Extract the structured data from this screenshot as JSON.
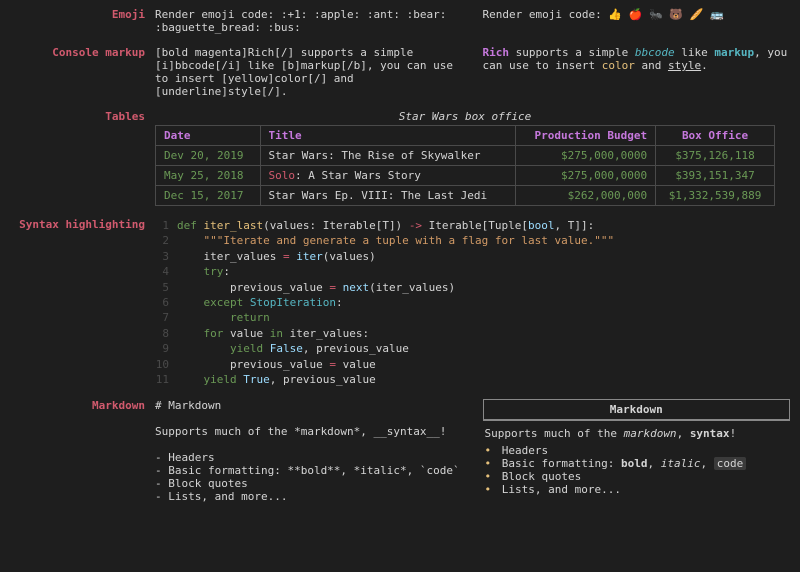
{
  "sections": {
    "emoji": {
      "label": "Emoji",
      "raw": "Render emoji code: :+1: :apple: :ant: :bear: :baguette_bread: :bus:",
      "rendered_prefix": "Render emoji code: ",
      "rendered_emoji": "👍 🍎 🐜 🐻 🥖 🚌"
    },
    "console": {
      "label": "Console markup",
      "raw": "[bold magenta]Rich[/] supports a simple [i]bbcode[/i] like [b]markup[/b], you can use to insert [yellow]color[/] and [underline]style[/].",
      "rich_word": "Rich",
      "text1": " supports a simple ",
      "bbcode": "bbcode",
      "text2": " like ",
      "markup": "markup",
      "text3": ", you can use to insert ",
      "color": "color",
      "text4": " and ",
      "style": "style",
      "text5": "."
    },
    "tables": {
      "label": "Tables",
      "title": "Star Wars box office",
      "headers": [
        "Date",
        "Title",
        "Production Budget",
        "Box Office"
      ],
      "rows": [
        {
          "date": "Dev 20, 2019",
          "title_pre": "",
          "title_hl": "",
          "title_post": "Star Wars: The Rise of Skywalker",
          "budget": "$275,000,0000",
          "box": "$375,126,118"
        },
        {
          "date": "May 25, 2018",
          "title_pre": "",
          "title_hl": "Solo",
          "title_post": ": A Star Wars Story",
          "budget": "$275,000,0000",
          "box": "$393,151,347"
        },
        {
          "date": "Dec 15, 2017",
          "title_pre": "",
          "title_hl": "",
          "title_post": "Star Wars Ep. VIII: The Last Jedi",
          "budget": "$262,000,000",
          "box": "$1,332,539,889"
        }
      ]
    },
    "syntax": {
      "label": "Syntax highlighting",
      "lines": [
        {
          "n": "1",
          "html": "<span class='kw'>def</span> <span class='fn'>iter_last</span>(values: Iterable[T]) <span class='op'>-&gt;</span> Iterable[Tuple[<span class='builtin'>bool</span>, T]]:"
        },
        {
          "n": "2",
          "html": "    <span class='str'>\"\"\"Iterate and generate a tuple with a flag for last value.\"\"\"</span>"
        },
        {
          "n": "3",
          "html": "    iter_values <span class='op'>=</span> <span class='builtin'>iter</span>(values)"
        },
        {
          "n": "4",
          "html": "    <span class='kw'>try</span>:"
        },
        {
          "n": "5",
          "html": "        previous_value <span class='op'>=</span> <span class='builtin'>next</span>(iter_values)"
        },
        {
          "n": "6",
          "html": "    <span class='kw'>except</span> <span class='cls'>StopIteration</span>:"
        },
        {
          "n": "7",
          "html": "        <span class='kw'>return</span>"
        },
        {
          "n": "8",
          "html": "    <span class='kw'>for</span> value <span class='kw'>in</span> iter_values:"
        },
        {
          "n": "9",
          "html": "        <span class='kw'>yield</span> <span class='builtin'>False</span>, previous_value"
        },
        {
          "n": "10",
          "html": "        previous_value <span class='op'>=</span> value"
        },
        {
          "n": "11",
          "html": "    <span class='kw'>yield</span> <span class='builtin'>True</span>, previous_value"
        }
      ]
    },
    "markdown": {
      "label": "Markdown",
      "raw_heading": "# Markdown",
      "raw_line": "Supports much of the *markdown*, __syntax__!",
      "raw_items": [
        "- Headers",
        "- Basic formatting: **bold**, *italic*, `code`",
        "- Block quotes",
        "- Lists, and more..."
      ],
      "box_title": "Markdown",
      "rendered_prefix": "Supports much of the ",
      "rendered_md": "markdown",
      "rendered_mid": ", ",
      "rendered_syntax": "syntax",
      "rendered_suffix": "!",
      "items": {
        "headers": "Headers",
        "fmt_prefix": "Basic formatting: ",
        "bold": "bold",
        "italic": "italic",
        "code": "code",
        "bq": "Block quotes",
        "lists": "Lists, and more..."
      }
    }
  }
}
